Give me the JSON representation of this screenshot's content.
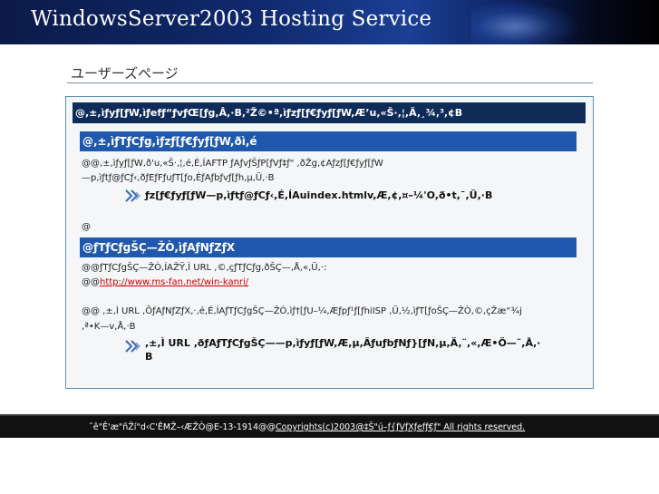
{
  "banner": {
    "title": "WindowsServer2003 Hosting Service"
  },
  "page": {
    "title": "ユーザーズページ"
  },
  "panel": {
    "header": "@,±,ìƒyƒ[ƒW,ìƒefƒ“ƒvƒŒ[ƒg,Å,·B,²Ž©•ª,ìƒzƒ[ƒ€ƒyƒ[ƒW,Æ’u,«Š·,¦,Ä,¸¾,³,¢B",
    "section1": {
      "title": "@,±,ìƒTƒCƒg,ìƒzƒ[ƒ€ƒyƒ[ƒW,ðì,é",
      "line1": "@@,±,ìƒyƒ[ƒW,ð'u,«Š·,¦,é,É,ÍAFTP ƒAƒvƒŠƒP[ƒVƒ‡ƒ\" ,ðŽg,¢Aƒzƒ[ƒ€ƒyƒ[ƒW",
      "line2": "—p,ìƒtƒ@ƒCƒ‹,ðƒEƒFƒuƒT[ƒo,ÉƒAƒbƒvƒ[ƒh,µ,Ü,·B",
      "note": "ƒz[ƒ€ƒyƒ[ƒW—p,ìƒtƒ@ƒCƒ‹,É,ÍAuindex.htmlv,Æ,¢,¤–¼'O,ð•t,¯,Ü,·B"
    },
    "blank_line": "@",
    "section2": {
      "title": "@ƒTƒCƒgŠÇ—ŽÒ,ìƒAƒNƒZƒX",
      "line1": "@@ƒTƒCƒgŠÇ—ŽÒ,ÍAŽŸ,Ì URL ,©,çƒTƒCƒg,ðŠÇ—,Å,«,Ü,·:",
      "line2_prefix": "@@",
      "link": "http://www.ms-fan.net/win-kanri/",
      "line3": "@@ ,±,Ì URL ,ÕƒAƒNƒZƒX,·,é,É,ÍAƒTƒCƒgŠÇ—ŽÒ,ìƒ†[ƒU–¼,Æƒpƒ¹ƒ[ƒhiISP ,Ü,½,ìƒT[ƒoŠÇ—ŽÒ,©,çŽæ“¾j",
      "line4": ",ª•K—v,Å,·B",
      "note1": ",±,Ì URL ,ðƒAƒTƒCƒgŠÇ——p,ìƒyƒ[ƒW,Æ,µ,ÄƒuƒbƒNƒ}[ƒN,µ,Ä,¨,«,Æ•Ö—˜,Å,·",
      "note2": "B"
    }
  },
  "footer": {
    "prefix": "ˆê\"Ê'æ\"ñŽí\"d‹C'ÊMŽ–‹ÆŽÒ@E-13-1914@@",
    "copyright": "Copyrights(c)2003@‡Š\"ú–ƒ{ƒVƒXƒefƒ€ƒ\" All rights reserved."
  },
  "colors": {
    "header_bar": "#0f2c59",
    "section_bar": "#2058ad",
    "panel_border": "#5a8fb7",
    "link": "#cc0000"
  },
  "icons": {
    "note_arrow": "double-arrow-icon"
  }
}
